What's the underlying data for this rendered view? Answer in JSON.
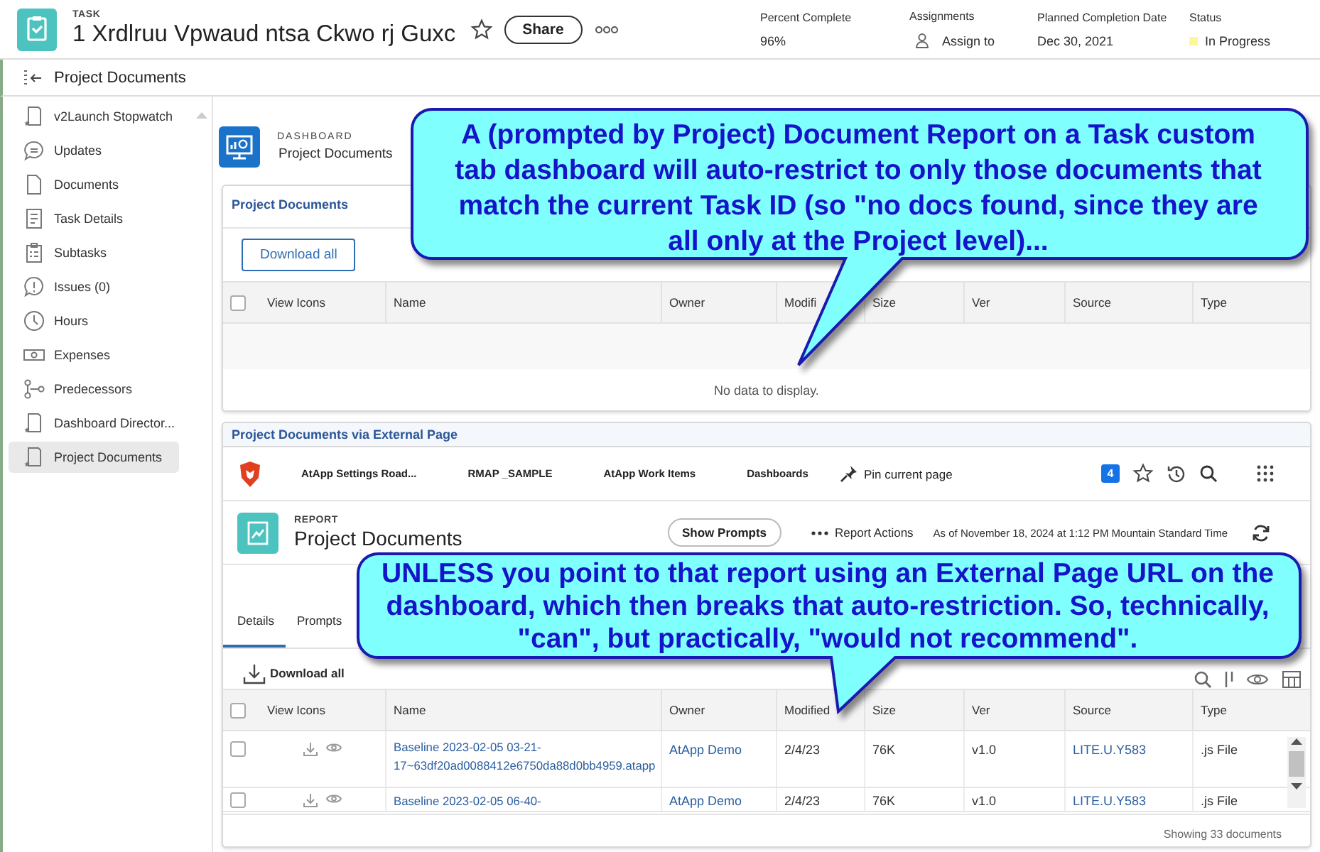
{
  "header": {
    "kind_label": "TASK",
    "title": "1 Xrdlruu Vpwaud ntsa Ckwo rj Guxc",
    "share": "Share",
    "fields": [
      {
        "label": "Percent Complete",
        "value": "96%",
        "kind": "text"
      },
      {
        "label": "Assignments",
        "value": "Assign to",
        "kind": "assign"
      },
      {
        "label": "Planned Completion Date",
        "value": "Dec 30, 2021",
        "kind": "text"
      },
      {
        "label": "Status",
        "value": "In Progress",
        "kind": "status",
        "color": "#fff59d"
      }
    ]
  },
  "breadcrumb": {
    "title": "Project Documents"
  },
  "sidebar": {
    "items": [
      {
        "label": "v2Launch Stopwatch",
        "kind": "dashboard",
        "selected": false
      },
      {
        "label": "Updates",
        "kind": "chat",
        "selected": false
      },
      {
        "label": "Documents",
        "kind": "page",
        "selected": false
      },
      {
        "label": "Task Details",
        "kind": "details",
        "selected": false
      },
      {
        "label": "Subtasks",
        "kind": "clipboard",
        "selected": false
      },
      {
        "label": "Issues (0)",
        "kind": "alert",
        "selected": false
      },
      {
        "label": "Hours",
        "kind": "clock",
        "selected": false
      },
      {
        "label": "Expenses",
        "kind": "money",
        "selected": false
      },
      {
        "label": "Predecessors",
        "kind": "flow",
        "selected": false
      },
      {
        "label": "Dashboard Director...",
        "kind": "dashboard",
        "selected": false
      },
      {
        "label": "Project Documents",
        "kind": "dashboard",
        "selected": true
      }
    ]
  },
  "dashboard": {
    "kind_label": "DASHBOARD",
    "title": "Project Documents"
  },
  "panel_1": {
    "title": "Project Documents",
    "button": "Download all",
    "select_all": {
      "checked": false
    },
    "columns": [
      "View Icons",
      "Name",
      "Owner",
      "Modifi",
      "Size",
      "Ver",
      "Source",
      "Type"
    ],
    "empty_message": "No data to display."
  },
  "panel_2": {
    "title": "Project Documents via External Page",
    "nav": {
      "links": [
        "AtApp Settings Road...",
        "RMAP _SAMPLE",
        "AtApp Work Items",
        "Dashboards"
      ],
      "pin": "Pin current page",
      "badge": "4"
    },
    "report": {
      "kind_label": "REPORT",
      "title": "Project Documents",
      "show_prompts": "Show Prompts",
      "actions": "Report Actions",
      "timestamp": "As of November 18, 2024 at 1:12 PM Mountain Standard Time"
    },
    "tabs": [
      {
        "label": "Details",
        "selected": true
      },
      {
        "label": "Prompts",
        "selected": false
      }
    ],
    "download": "Download all",
    "select_all": {
      "checked": false
    },
    "columns": [
      "View Icons",
      "Name",
      "Owner",
      "Modified",
      "Size",
      "Ver",
      "Source",
      "Type"
    ],
    "rows": [
      {
        "checked": false,
        "name": "Baseline 2023-02-05 03-21-17~63df20ad0088412e6750da88d0bb4959.atapp",
        "owner": "AtApp Demo",
        "modified": "2/4/23",
        "size": "76K",
        "ver": "v1.0",
        "source": "LITE.U.Y583",
        "type": ".js File"
      },
      {
        "checked": false,
        "name": "Baseline 2023-02-05 06-40-",
        "owner": "AtApp Demo",
        "modified": "2/4/23",
        "size": "76K",
        "ver": "v1.0",
        "source": "LITE.U.Y583",
        "type": ".js File"
      }
    ],
    "footer": "Showing 33 documents"
  },
  "callouts": [
    {
      "text": "A (prompted by Project) Document Report on a Task custom tab dashboard will auto-restrict to only those documents that match the current Task ID (so \"no docs found, since they are all only at the Project level)..."
    },
    {
      "text": "UNLESS you point to that report using an External Page URL on the dashboard, which then breaks that auto-restriction. So, technically, \"can\", but practically, \"would not recommend\"."
    }
  ]
}
